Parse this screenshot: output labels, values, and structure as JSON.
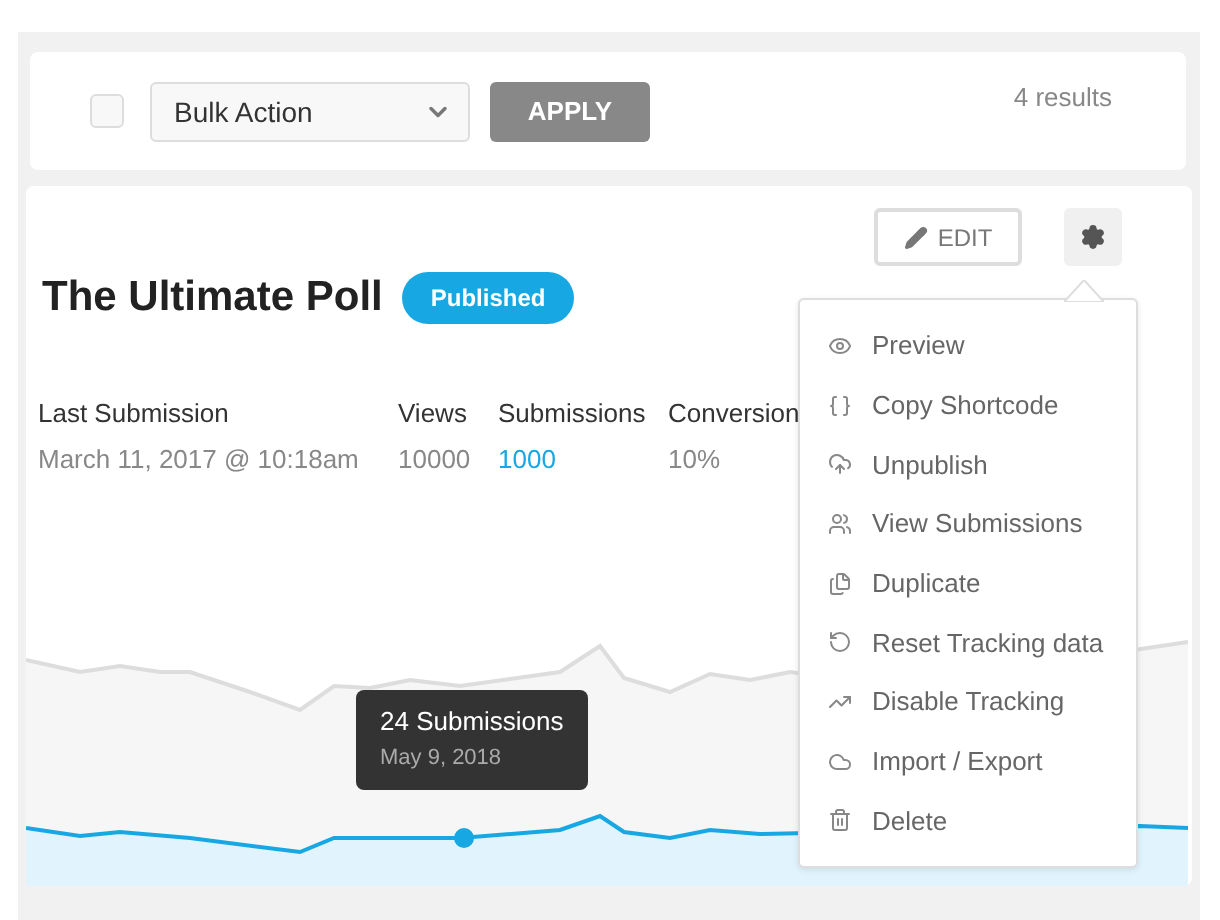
{
  "toolbar": {
    "select_all": {
      "checked": false
    },
    "bulk_action": {
      "value": "Bulk Action"
    },
    "apply_button": "APPLY",
    "results": "4 results"
  },
  "poll": {
    "title": "The Ultimate Poll",
    "status": "Published",
    "edit_button": "EDIT",
    "stats": [
      {
        "label": "Last Submission",
        "value": "March 11, 2017 @ 10:18am",
        "kind": "plain"
      },
      {
        "label": "Views",
        "value": "10000",
        "kind": "plain"
      },
      {
        "label": "Submissions",
        "value": "1000",
        "kind": "link"
      },
      {
        "label": "Conversion",
        "value": "10%",
        "kind": "plain"
      }
    ],
    "tooltip": {
      "title": "24 Submissions",
      "date": "May 9, 2018"
    },
    "menu": [
      {
        "label": "Preview",
        "kind": "eye"
      },
      {
        "label": "Copy Shortcode",
        "kind": "braces"
      },
      {
        "label": "Unpublish",
        "kind": "cloud"
      },
      {
        "label": "View Submissions",
        "kind": "users"
      },
      {
        "label": "Duplicate",
        "kind": "copy"
      },
      {
        "label": "Reset Tracking data",
        "kind": "reset"
      },
      {
        "label": "Disable Tracking",
        "kind": "trend"
      },
      {
        "label": "Import / Export",
        "kind": "import"
      },
      {
        "label": "Delete",
        "kind": "trash"
      }
    ]
  }
}
